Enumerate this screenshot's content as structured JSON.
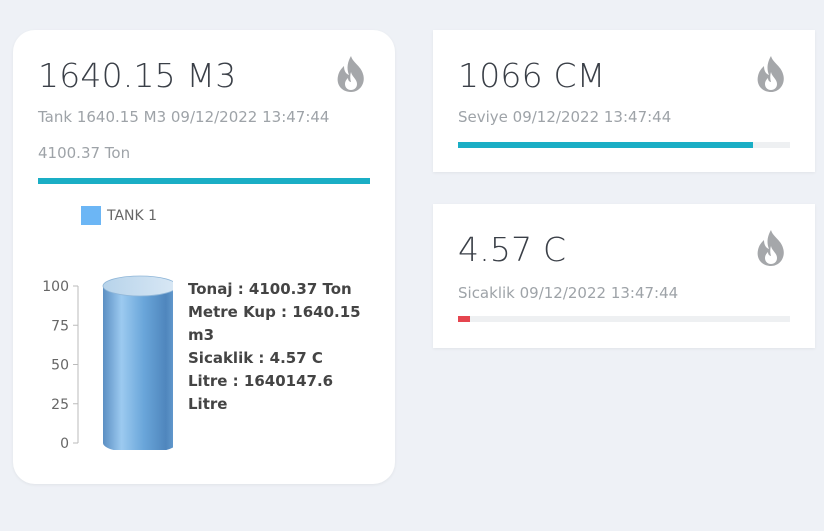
{
  "tank_card": {
    "value": "1640.15 M3",
    "subtitle": "Tank 1640.15 M3 09/12/2022 13:47:44",
    "tonnage": "4100.37 Ton",
    "bar_fraction": 1.0,
    "bar_color": "#1aaec5",
    "icon": "flame-icon",
    "legend_label": "TANK 1",
    "legend_color": "#6cb6f5",
    "info": {
      "tonaj": "Tonaj : 4100.37 Ton",
      "metre_kup_a": "Metre Kup : 1640.15",
      "metre_kup_b": "m3",
      "sicaklik": "Sicaklik : 4.57 C",
      "litre": "Litre : 1640147.6 Litre"
    }
  },
  "level_card": {
    "value": "1066 CM",
    "subtitle": "Seviye 09/12/2022 13:47:44",
    "bar_fraction": 0.89,
    "bar_color": "#1aaec5",
    "icon": "flame-icon"
  },
  "temp_card": {
    "value": "4.57 C",
    "subtitle": "Sicaklik 09/12/2022 13:47:44",
    "bar_fraction": 0.035,
    "bar_color": "#e5454f",
    "icon": "flame-icon"
  },
  "chart_data": {
    "type": "bar",
    "categories": [
      "TANK 1"
    ],
    "series": [
      {
        "name": "TANK 1",
        "values": [
          100
        ]
      }
    ],
    "ylim": [
      0,
      100
    ],
    "yticks": [
      "0",
      "25",
      "50",
      "75",
      "100"
    ],
    "legend": "top"
  }
}
